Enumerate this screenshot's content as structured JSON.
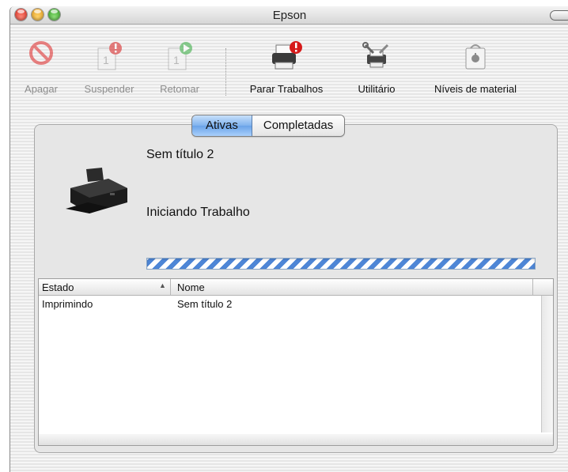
{
  "window": {
    "title": "Epson"
  },
  "toolbar": {
    "items": [
      {
        "label": "Apagar",
        "icon": "delete-icon",
        "enabled": false
      },
      {
        "label": "Suspender",
        "icon": "hold-job-icon",
        "enabled": false
      },
      {
        "label": "Retomar",
        "icon": "resume-job-icon",
        "enabled": false
      },
      {
        "label": "Parar Trabalhos",
        "icon": "stop-jobs-printer-icon",
        "enabled": true
      },
      {
        "label": "Utilitário",
        "icon": "utility-tools-icon",
        "enabled": true
      },
      {
        "label": "Níveis de material",
        "icon": "supply-levels-icon",
        "enabled": true
      }
    ]
  },
  "tabs": {
    "active": "Ativas",
    "completed": "Completadas"
  },
  "job": {
    "title": "Sem título 2",
    "status": "Iniciando Trabalho",
    "progress": "indeterminate"
  },
  "table": {
    "columns": [
      "Estado",
      "Nome"
    ],
    "sort_column": "Estado",
    "rows": [
      {
        "estado": "Imprimindo",
        "nome": "Sem título 2"
      }
    ]
  },
  "colors": {
    "accent": "#6aa3e8",
    "progress_stripe": "#4e86d6",
    "alert_badge": "#d61a1a",
    "resume_badge": "#2fa83a"
  }
}
